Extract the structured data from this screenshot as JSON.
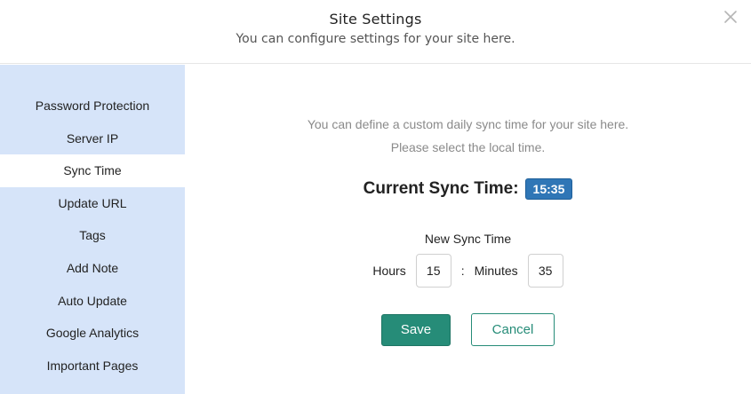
{
  "header": {
    "title": "Site Settings",
    "subtitle": "You can configure settings for your site here.",
    "close_icon": "close-icon"
  },
  "sidebar": {
    "items": [
      {
        "label": "Password Protection",
        "active": false
      },
      {
        "label": "Server IP",
        "active": false
      },
      {
        "label": "Sync Time",
        "active": true
      },
      {
        "label": "Update URL",
        "active": false
      },
      {
        "label": "Tags",
        "active": false
      },
      {
        "label": "Add Note",
        "active": false
      },
      {
        "label": "Auto Update",
        "active": false
      },
      {
        "label": "Google Analytics",
        "active": false
      },
      {
        "label": "Important Pages",
        "active": false
      }
    ]
  },
  "main": {
    "intro_line1": "You can define a custom daily sync time for your site here.",
    "intro_line2": "Please select the local time.",
    "current_label": "Current Sync Time:",
    "current_time": "15:35",
    "new_sync_label": "New Sync Time",
    "hours_label": "Hours",
    "hours_value": "15",
    "separator": ":",
    "minutes_label": "Minutes",
    "minutes_value": "35",
    "save_label": "Save",
    "cancel_label": "Cancel"
  },
  "colors": {
    "sidebar_bg": "#d6e4f9",
    "accent_green": "#268c78",
    "badge_blue": "#2f76b6"
  }
}
